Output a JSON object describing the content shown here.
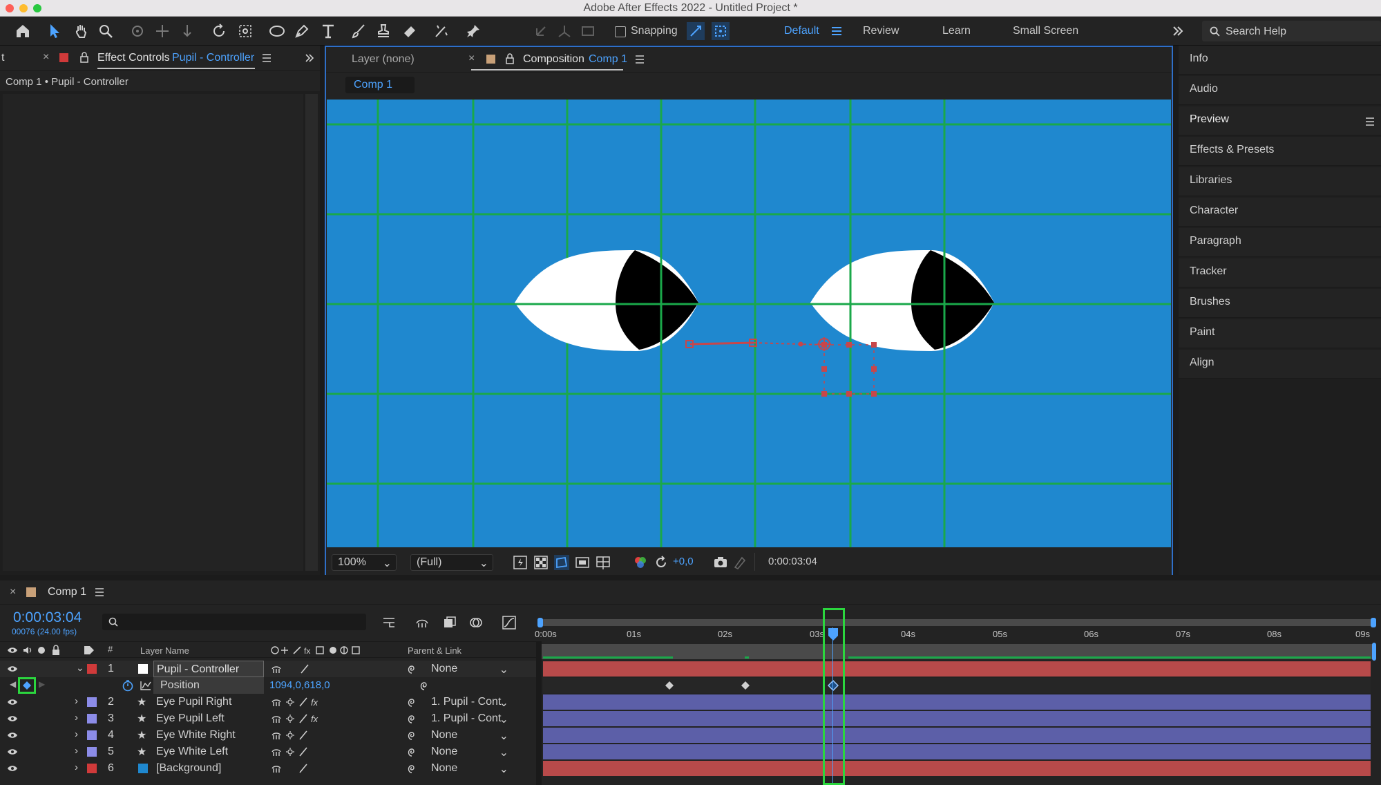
{
  "app": {
    "title": "Adobe After Effects 2022 - Untitled Project *"
  },
  "toolbar": {
    "snapping_label": "Snapping",
    "workspaces": [
      "Default",
      "Review",
      "Learn",
      "Small Screen"
    ],
    "active_workspace": "Default",
    "search_placeholder": "Search Help"
  },
  "effect_panel": {
    "left_tab_stub": "t",
    "tab_prefix": "Effect Controls",
    "tab_layer": "Pupil - Controller",
    "breadcrumb": "Comp 1 • Pupil - Controller"
  },
  "comp_panel": {
    "layer_tab": "Layer (none)",
    "comp_tab_prefix": "Composition",
    "comp_tab_name": "Comp 1",
    "comp_chip": "Comp 1",
    "zoom": "100%",
    "resolution": "(Full)",
    "exposure": "+0,0",
    "timecode": "0:00:03:04"
  },
  "right_panel": {
    "items": [
      "Info",
      "Audio",
      "Preview",
      "Effects & Presets",
      "Libraries",
      "Character",
      "Paragraph",
      "Tracker",
      "Brushes",
      "Paint",
      "Align"
    ]
  },
  "timeline": {
    "tab": "Comp 1",
    "timecode": "0:00:03:04",
    "frame_info": "00076 (24.00 fps)",
    "col_layer_name": "Layer Name",
    "col_num": "#",
    "col_parent": "Parent & Link",
    "ruler": [
      "0:00s",
      "01s",
      "02s",
      "03s",
      "04s",
      "05s",
      "06s",
      "07s",
      "08s",
      "09s"
    ],
    "layers": [
      {
        "num": "1",
        "name": "Pupil - Controller",
        "parent": "None",
        "color": "#d03a3a",
        "type": "solid"
      },
      {
        "num": "2",
        "name": "Eye Pupil Right",
        "parent": "1. Pupil - Cont",
        "color": "#8c8ce8",
        "type": "shape"
      },
      {
        "num": "3",
        "name": "Eye Pupil Left",
        "parent": "1. Pupil - Cont",
        "color": "#8c8ce8",
        "type": "shape"
      },
      {
        "num": "4",
        "name": "Eye White Right",
        "parent": "None",
        "color": "#8c8ce8",
        "type": "shape"
      },
      {
        "num": "5",
        "name": "Eye White Left",
        "parent": "None",
        "color": "#8c8ce8",
        "type": "shape"
      },
      {
        "num": "6",
        "name": "[Background]",
        "parent": "None",
        "color": "#d03a3a",
        "type": "solid"
      }
    ],
    "property": {
      "name": "Position",
      "value": "1094,0,618,0"
    }
  },
  "colors": {
    "accent": "#4da3ff",
    "viewer_bg": "#1f88cf",
    "grid": "#1aa84a",
    "bar_red": "#b84a4a",
    "bar_blue": "#5c5fa8",
    "highlight": "#2bd63e"
  }
}
